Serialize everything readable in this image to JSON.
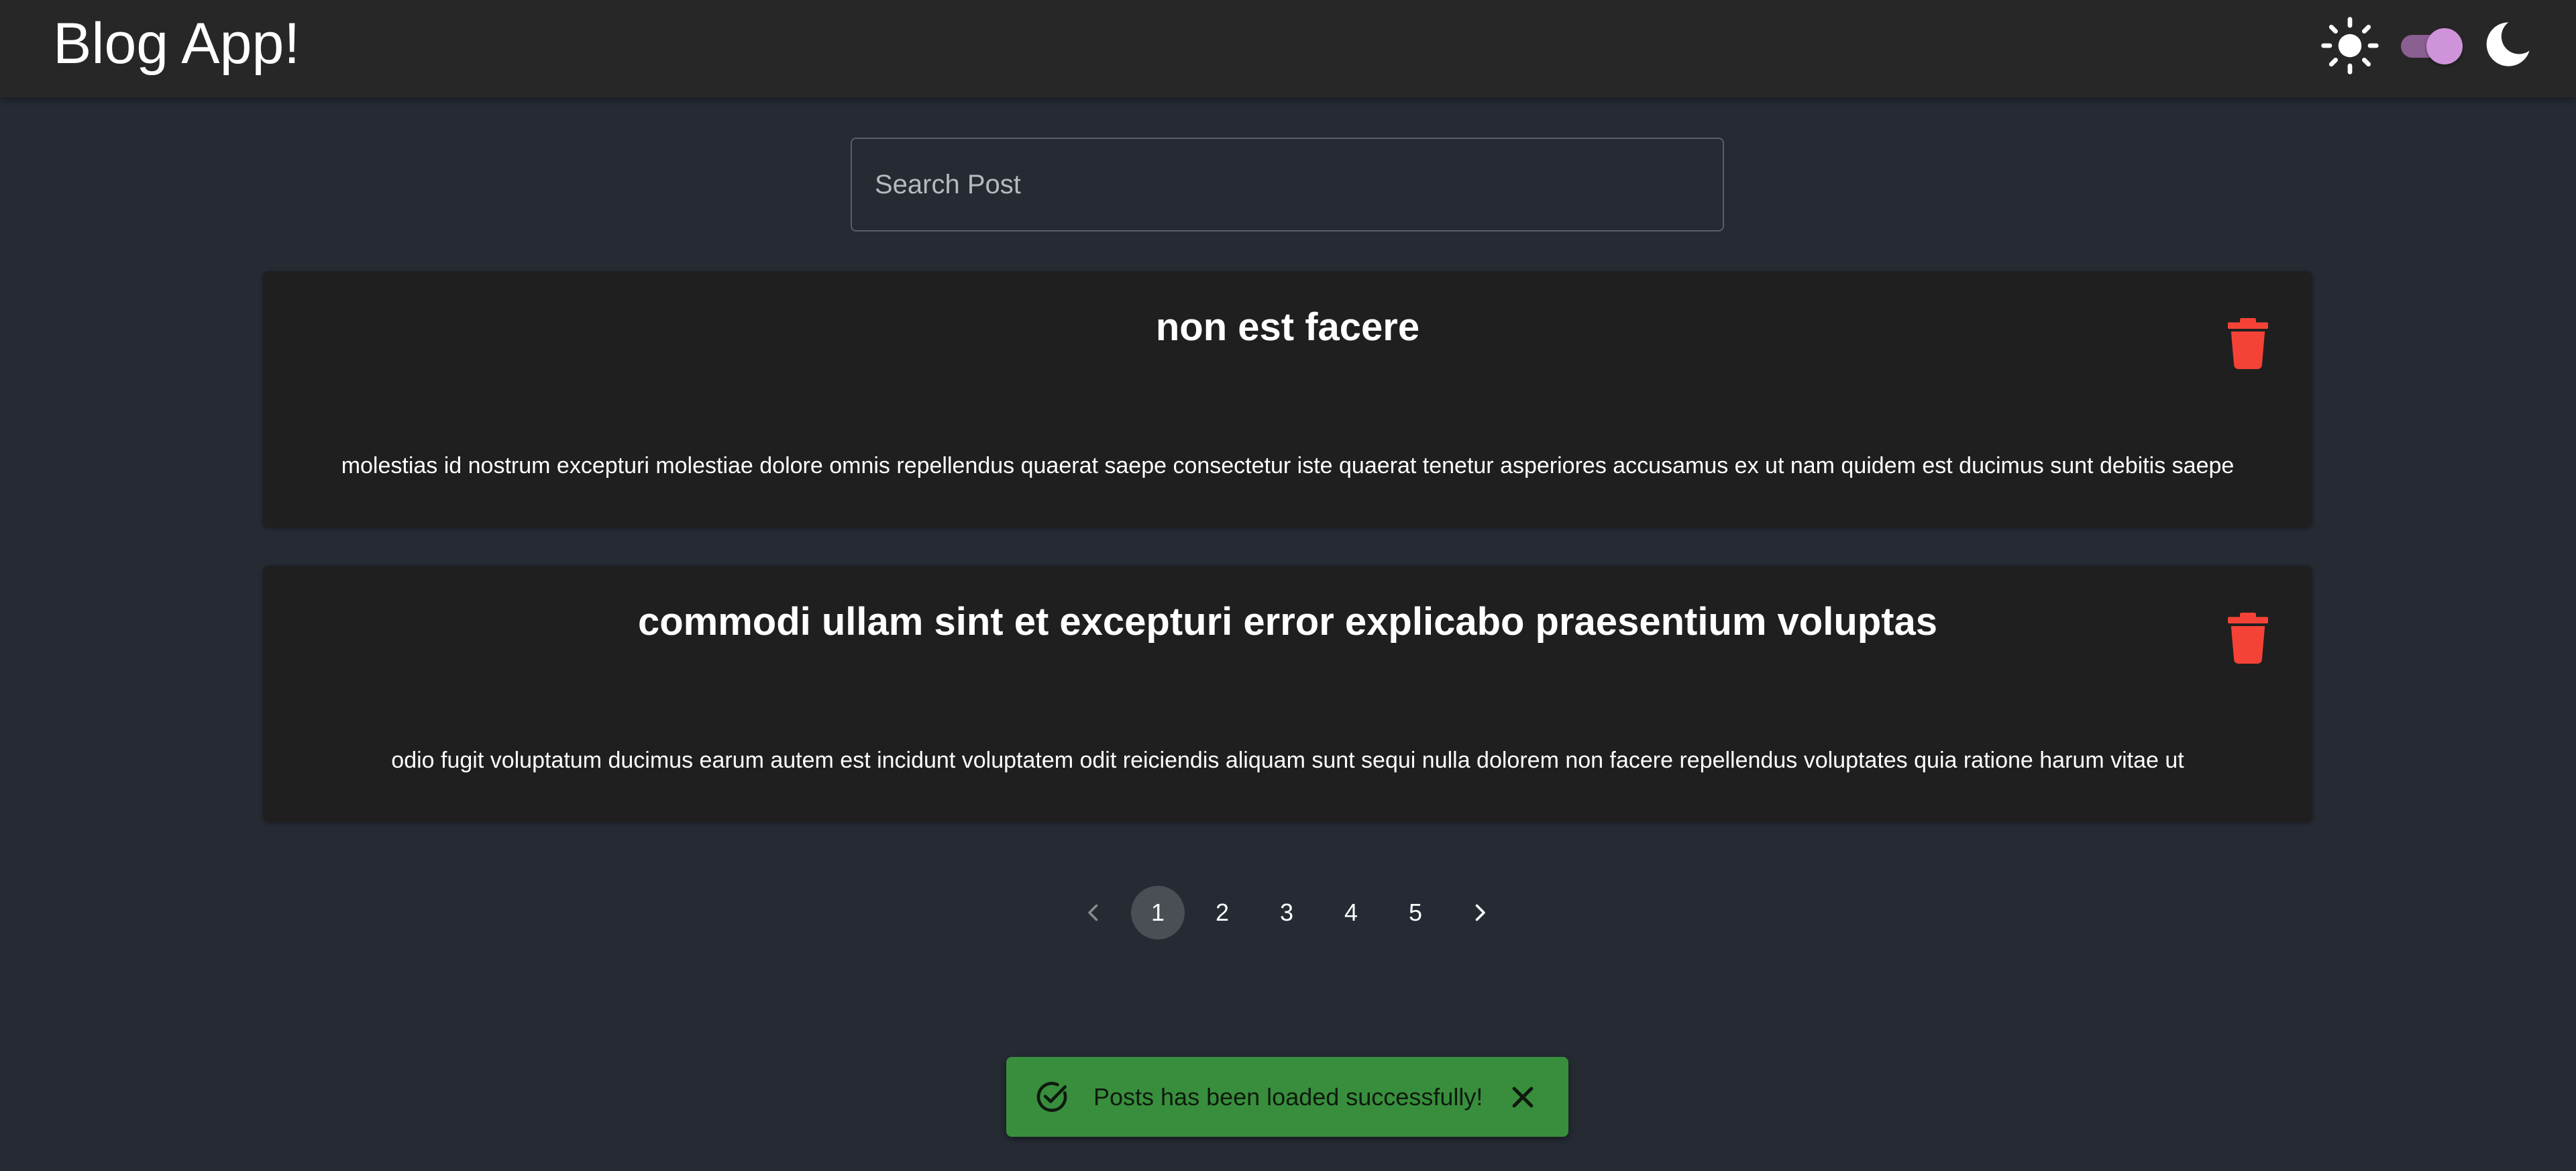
{
  "app": {
    "title": "Blog App!",
    "theme_icons": {
      "light": "sun-icon",
      "dark": "moon-icon"
    },
    "theme_toggle_checked": true
  },
  "search": {
    "placeholder": "Search Post",
    "value": ""
  },
  "posts": [
    {
      "title": "non est facere",
      "body": "molestias id nostrum excepturi molestiae dolore omnis repellendus quaerat saepe consectetur iste quaerat tenetur asperiores accusamus ex ut nam quidem est ducimus sunt debitis saepe",
      "delete_icon": "trash-icon"
    },
    {
      "title": "commodi ullam sint et excepturi error explicabo praesentium voluptas",
      "body": "odio fugit voluptatum ducimus earum autem est incidunt voluptatem odit reiciendis aliquam sunt sequi nulla dolorem non facere repellendus voluptates quia ratione harum vitae ut",
      "delete_icon": "trash-icon"
    }
  ],
  "pagination": {
    "prev_icon": "chevron-left-icon",
    "next_icon": "chevron-right-icon",
    "pages": [
      "1",
      "2",
      "3",
      "4",
      "5"
    ],
    "current": "1"
  },
  "snackbar": {
    "message": "Posts has been loaded successfully!",
    "icon": "check-circle-icon",
    "close_icon": "close-icon"
  },
  "colors": {
    "background": "#252a33",
    "appbar": "#272727",
    "card": "#1f1f1f",
    "delete": "#f44336",
    "success": "#388e3c",
    "switch_thumb": "#cf93d9",
    "switch_track": "#8a5f92",
    "page_selected": "#4a4e55"
  }
}
